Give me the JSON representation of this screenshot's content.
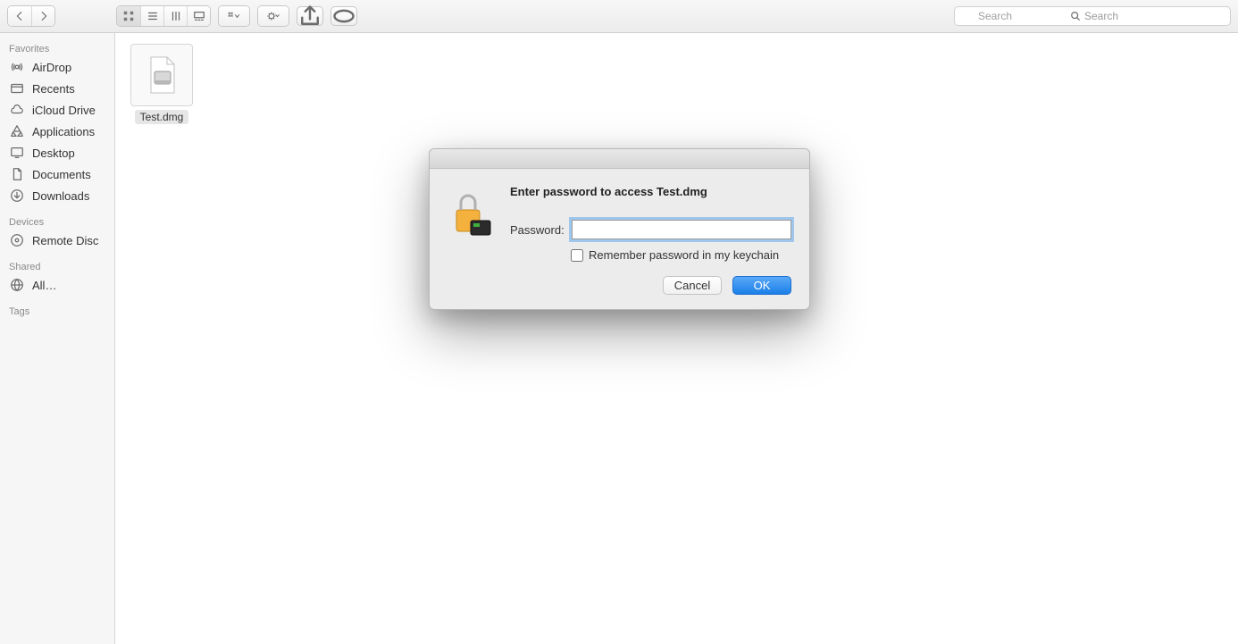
{
  "toolbar": {
    "search_placeholder": "Search"
  },
  "sidebar": {
    "sections": [
      {
        "title": "Favorites",
        "items": [
          {
            "label": "AirDrop",
            "icon": "airdrop-icon"
          },
          {
            "label": "Recents",
            "icon": "recents-icon"
          },
          {
            "label": "iCloud Drive",
            "icon": "cloud-icon"
          },
          {
            "label": "Applications",
            "icon": "applications-icon"
          },
          {
            "label": "Desktop",
            "icon": "desktop-icon"
          },
          {
            "label": "Documents",
            "icon": "documents-icon"
          },
          {
            "label": "Downloads",
            "icon": "downloads-icon"
          }
        ]
      },
      {
        "title": "Devices",
        "items": [
          {
            "label": "Remote Disc",
            "icon": "disc-icon"
          }
        ]
      },
      {
        "title": "Shared",
        "items": [
          {
            "label": "All…",
            "icon": "globe-icon"
          }
        ]
      },
      {
        "title": "Tags",
        "items": []
      }
    ]
  },
  "content": {
    "files": [
      {
        "name": "Test.dmg",
        "icon": "dmg-file-icon",
        "selected": true
      }
    ]
  },
  "dialog": {
    "heading": "Enter password to access Test.dmg",
    "password_label": "Password:",
    "password_value": "",
    "remember_label": "Remember password in my keychain",
    "remember_checked": false,
    "cancel_label": "Cancel",
    "ok_label": "OK"
  }
}
